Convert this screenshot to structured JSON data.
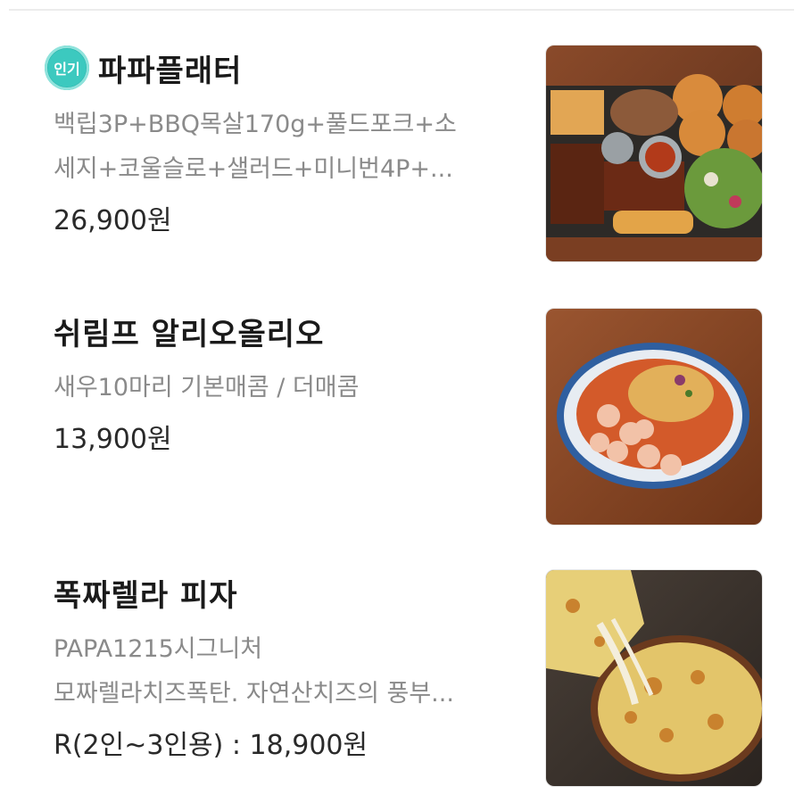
{
  "menu": {
    "items": [
      {
        "badge": "인기",
        "title": "파파플래터",
        "desc_line1": "백립3P+BBQ목살170g+풀드포크+소",
        "desc_line2": "세지+코울슬로+샐러드+미니번4P+...",
        "price": "26,900원",
        "image": "platter-photo"
      },
      {
        "title": "쉬림프 알리오올리오",
        "desc_line1": "새우10마리 기본매콤 / 더매콤",
        "price": "13,900원",
        "image": "shrimp-pasta-photo"
      },
      {
        "title": "폭짜렐라 피자",
        "desc_line1": "PAPA1215시그니처",
        "desc_line2": "모짜렐라치즈폭탄. 자연산치즈의 풍부...",
        "price": "R(2인~3인용) : 18,900원",
        "image": "pizza-photo"
      }
    ]
  },
  "colors": {
    "badge": "#2fbdb3",
    "title": "#1a1a1a",
    "desc": "#8a8a8a",
    "price": "#2a2a2a"
  }
}
